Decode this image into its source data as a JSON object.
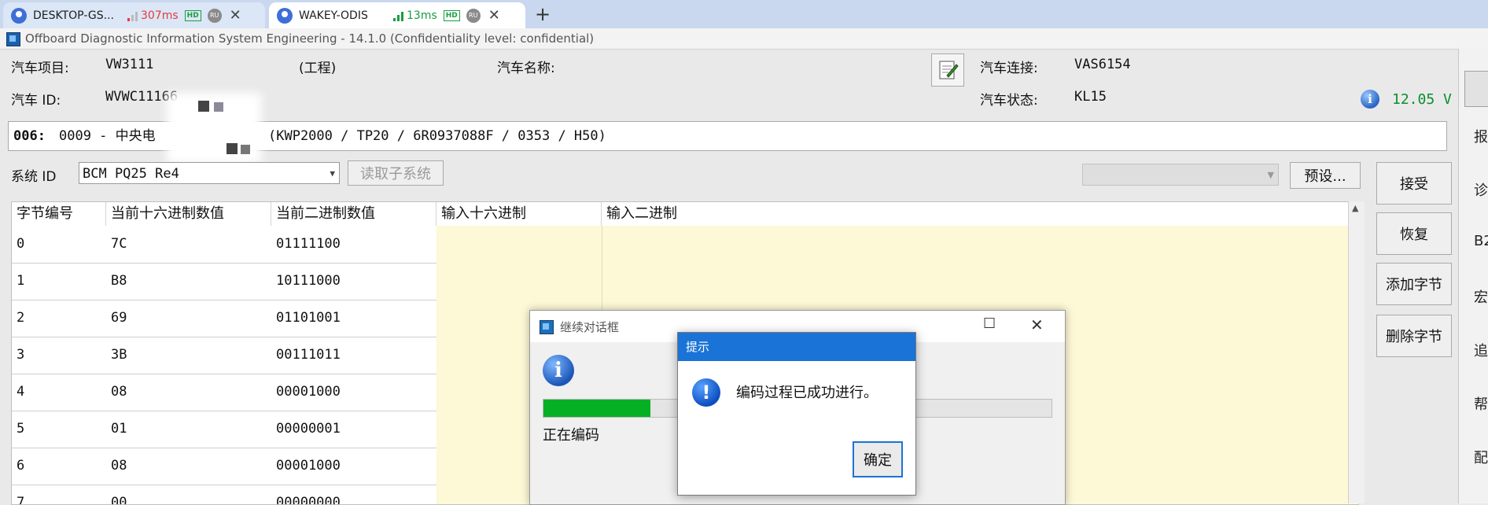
{
  "browser": {
    "tabs": [
      {
        "title": "DESKTOP-GS...",
        "ping": "307ms",
        "quality": "HD",
        "lang": "RU",
        "close": "✕"
      },
      {
        "title": "WAKEY-ODIS",
        "ping": "13ms",
        "quality": "HD",
        "lang": "RU",
        "close": "✕"
      }
    ],
    "new_tab": "+"
  },
  "app": {
    "title": "Offboard Diagnostic Information System Engineering - 14.1.0 (Confidentiality level: confidential)"
  },
  "vehicle": {
    "project_label": "汽车项目:",
    "project_value": "VW3111",
    "project_note": "(工程)",
    "name_label": "汽车名称:",
    "id_label": "汽车 ID:",
    "id_value": "WVWC11166",
    "connection_label": "汽车连接:",
    "connection_value": "VAS6154",
    "status_label": "汽车状态:",
    "status_value": "KL15",
    "voltage": "12.05 V"
  },
  "ecu_info": {
    "prefix": "006:",
    "text": "0009 - 中央电",
    "details": "(KWP2000 / TP20 / 6R0937088F / 0353 / H50)"
  },
  "system": {
    "label": "系统 ID",
    "selected": "BCM PQ25 Re4",
    "read_subsystem": "读取子系统",
    "preset": "预设..."
  },
  "table": {
    "headers": [
      "字节编号",
      "当前十六进制数值",
      "当前二进制数值",
      "输入十六进制",
      "输入二进制"
    ],
    "rows": [
      {
        "byte": "0",
        "hex": "7C",
        "bin": "01111100"
      },
      {
        "byte": "1",
        "hex": "B8",
        "bin": "10111000"
      },
      {
        "byte": "2",
        "hex": "69",
        "bin": "01101001"
      },
      {
        "byte": "3",
        "hex": "3B",
        "bin": "00111011"
      },
      {
        "byte": "4",
        "hex": "08",
        "bin": "00001000"
      },
      {
        "byte": "5",
        "hex": "01",
        "bin": "00000001"
      },
      {
        "byte": "6",
        "hex": "08",
        "bin": "00001000"
      },
      {
        "byte": "7",
        "hex": "00",
        "bin": "00000000"
      }
    ]
  },
  "side_buttons": {
    "accept": "接受",
    "restore": "恢复",
    "add_byte": "添加字节",
    "delete_byte": "删除字节"
  },
  "edge_panel": [
    "报",
    "诊",
    "B2",
    "宏",
    "追",
    "帮",
    "配"
  ],
  "continue_dialog": {
    "title": "继续对话框",
    "progress": 0.21,
    "status": "正在编码"
  },
  "prompt_dialog": {
    "title": "提示",
    "message": "编码过程已成功进行。",
    "ok": "确定"
  },
  "colors": {
    "progress_green": "#06b025",
    "dialog_title_blue": "#1a73d6",
    "edit_area_yellow": "#fdf8d6",
    "voltage_green": "#0a8f2e"
  }
}
